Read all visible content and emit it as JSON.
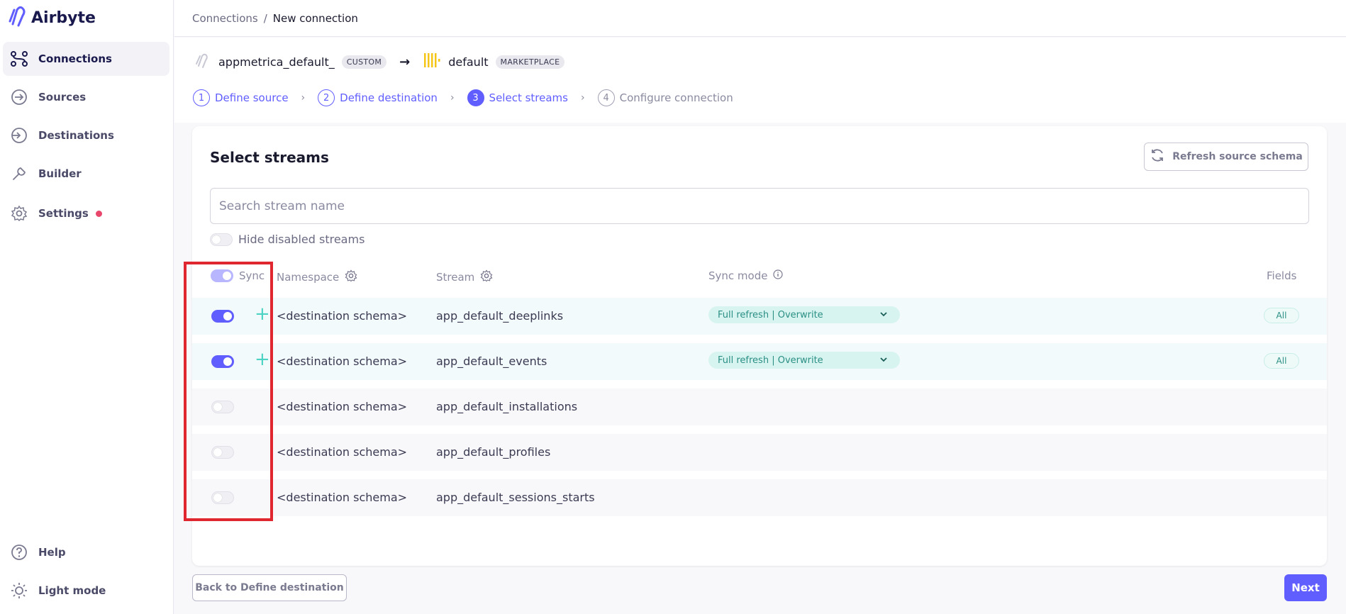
{
  "app": {
    "name": "Airbyte"
  },
  "sidebar": {
    "items": [
      {
        "label": "Connections",
        "icon": "connections-icon",
        "active": true
      },
      {
        "label": "Sources",
        "icon": "sources-icon"
      },
      {
        "label": "Destinations",
        "icon": "destinations-icon"
      },
      {
        "label": "Builder",
        "icon": "builder-icon"
      },
      {
        "label": "Settings",
        "icon": "gear-icon",
        "notification": true
      }
    ],
    "bottom": [
      {
        "label": "Help",
        "icon": "help-icon"
      },
      {
        "label": "Light mode",
        "icon": "sun-icon"
      }
    ]
  },
  "breadcrumb": {
    "parent": "Connections",
    "separator": "/",
    "current": "New connection"
  },
  "connection": {
    "source_name": "appmetrica_default_",
    "source_badge": "CUSTOM",
    "arrow": "→",
    "destination_name": "default",
    "destination_badge": "MARKETPLACE"
  },
  "steps": [
    {
      "num": "1",
      "label": "Define source",
      "state": "done"
    },
    {
      "num": "2",
      "label": "Define destination",
      "state": "done"
    },
    {
      "num": "3",
      "label": "Select streams",
      "state": "current"
    },
    {
      "num": "4",
      "label": "Configure connection",
      "state": "future"
    }
  ],
  "card": {
    "title": "Select streams",
    "refresh_label": "Refresh source schema",
    "search_placeholder": "Search stream name",
    "hide_disabled_label": "Hide disabled streams"
  },
  "table": {
    "headers": {
      "sync": "Sync",
      "namespace": "Namespace",
      "stream": "Stream",
      "sync_mode": "Sync mode",
      "fields": "Fields"
    },
    "rows": [
      {
        "enabled": true,
        "namespace": "<destination schema>",
        "stream": "app_default_deeplinks",
        "sync_mode": "Full refresh | Overwrite",
        "fields": "All"
      },
      {
        "enabled": true,
        "namespace": "<destination schema>",
        "stream": "app_default_events",
        "sync_mode": "Full refresh | Overwrite",
        "fields": "All"
      },
      {
        "enabled": false,
        "namespace": "<destination schema>",
        "stream": "app_default_installations",
        "sync_mode": "",
        "fields": ""
      },
      {
        "enabled": false,
        "namespace": "<destination schema>",
        "stream": "app_default_profiles",
        "sync_mode": "",
        "fields": ""
      },
      {
        "enabled": false,
        "namespace": "<destination schema>",
        "stream": "app_default_sessions_starts",
        "sync_mode": "",
        "fields": ""
      }
    ]
  },
  "footer": {
    "back_label": "Back to Define destination",
    "next_label": "Next"
  },
  "colors": {
    "accent": "#615eff",
    "highlight": "#e0262f",
    "teal": "#2a8f84"
  }
}
